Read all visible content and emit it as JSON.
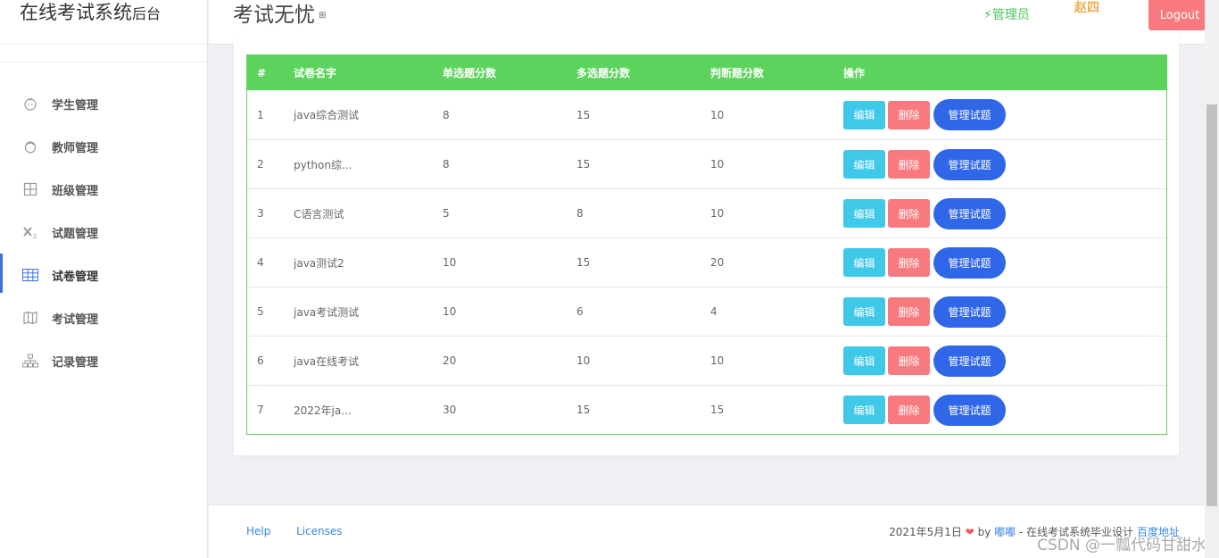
{
  "brand": {
    "main": "在线考试系统",
    "sub": "后台"
  },
  "header": {
    "title": "考试无忧",
    "role": "管理员",
    "username": "赵四",
    "logout": "Logout"
  },
  "sidebar": {
    "items": [
      {
        "label": "学生管理",
        "icon": "student-icon",
        "active": false
      },
      {
        "label": "教师管理",
        "icon": "teacher-icon",
        "active": false
      },
      {
        "label": "班级管理",
        "icon": "class-grid-icon",
        "active": false
      },
      {
        "label": "试题管理",
        "icon": "subscript-icon",
        "active": false
      },
      {
        "label": "试卷管理",
        "icon": "table-icon",
        "active": true
      },
      {
        "label": "考试管理",
        "icon": "map-icon",
        "active": false
      },
      {
        "label": "记录管理",
        "icon": "sitemap-icon",
        "active": false
      }
    ]
  },
  "table": {
    "headers": [
      "#",
      "试卷名字",
      "单选题分数",
      "多选题分数",
      "判断题分数",
      "操作"
    ],
    "rows": [
      [
        "1",
        "java综合测试",
        "8",
        "15",
        "10"
      ],
      [
        "2",
        "python综...",
        "8",
        "15",
        "10"
      ],
      [
        "3",
        "C语言测试",
        "5",
        "8",
        "10"
      ],
      [
        "4",
        "java测试2",
        "10",
        "15",
        "20"
      ],
      [
        "5",
        "java考试测试",
        "10",
        "6",
        "4"
      ],
      [
        "6",
        "java在线考试",
        "20",
        "10",
        "10"
      ],
      [
        "7",
        "2022年ja...",
        "30",
        "15",
        "15"
      ]
    ],
    "actions": {
      "edit": "编辑",
      "delete": "删除",
      "manage": "管理试题"
    }
  },
  "footer": {
    "help": "Help",
    "licenses": "Licenses",
    "date": "2021年5月1日",
    "by": "by",
    "author": "嘟嘟",
    "desc": "- 在线考试系统毕业设计",
    "link": "百度地址"
  },
  "watermark": "CSDN @一瓢代码甘甜水",
  "colors": {
    "accent": "#3b6ee8",
    "header_green": "#5cd35c",
    "edit": "#3fc8e8",
    "delete": "#f87a7f",
    "manage": "#3066e8"
  }
}
